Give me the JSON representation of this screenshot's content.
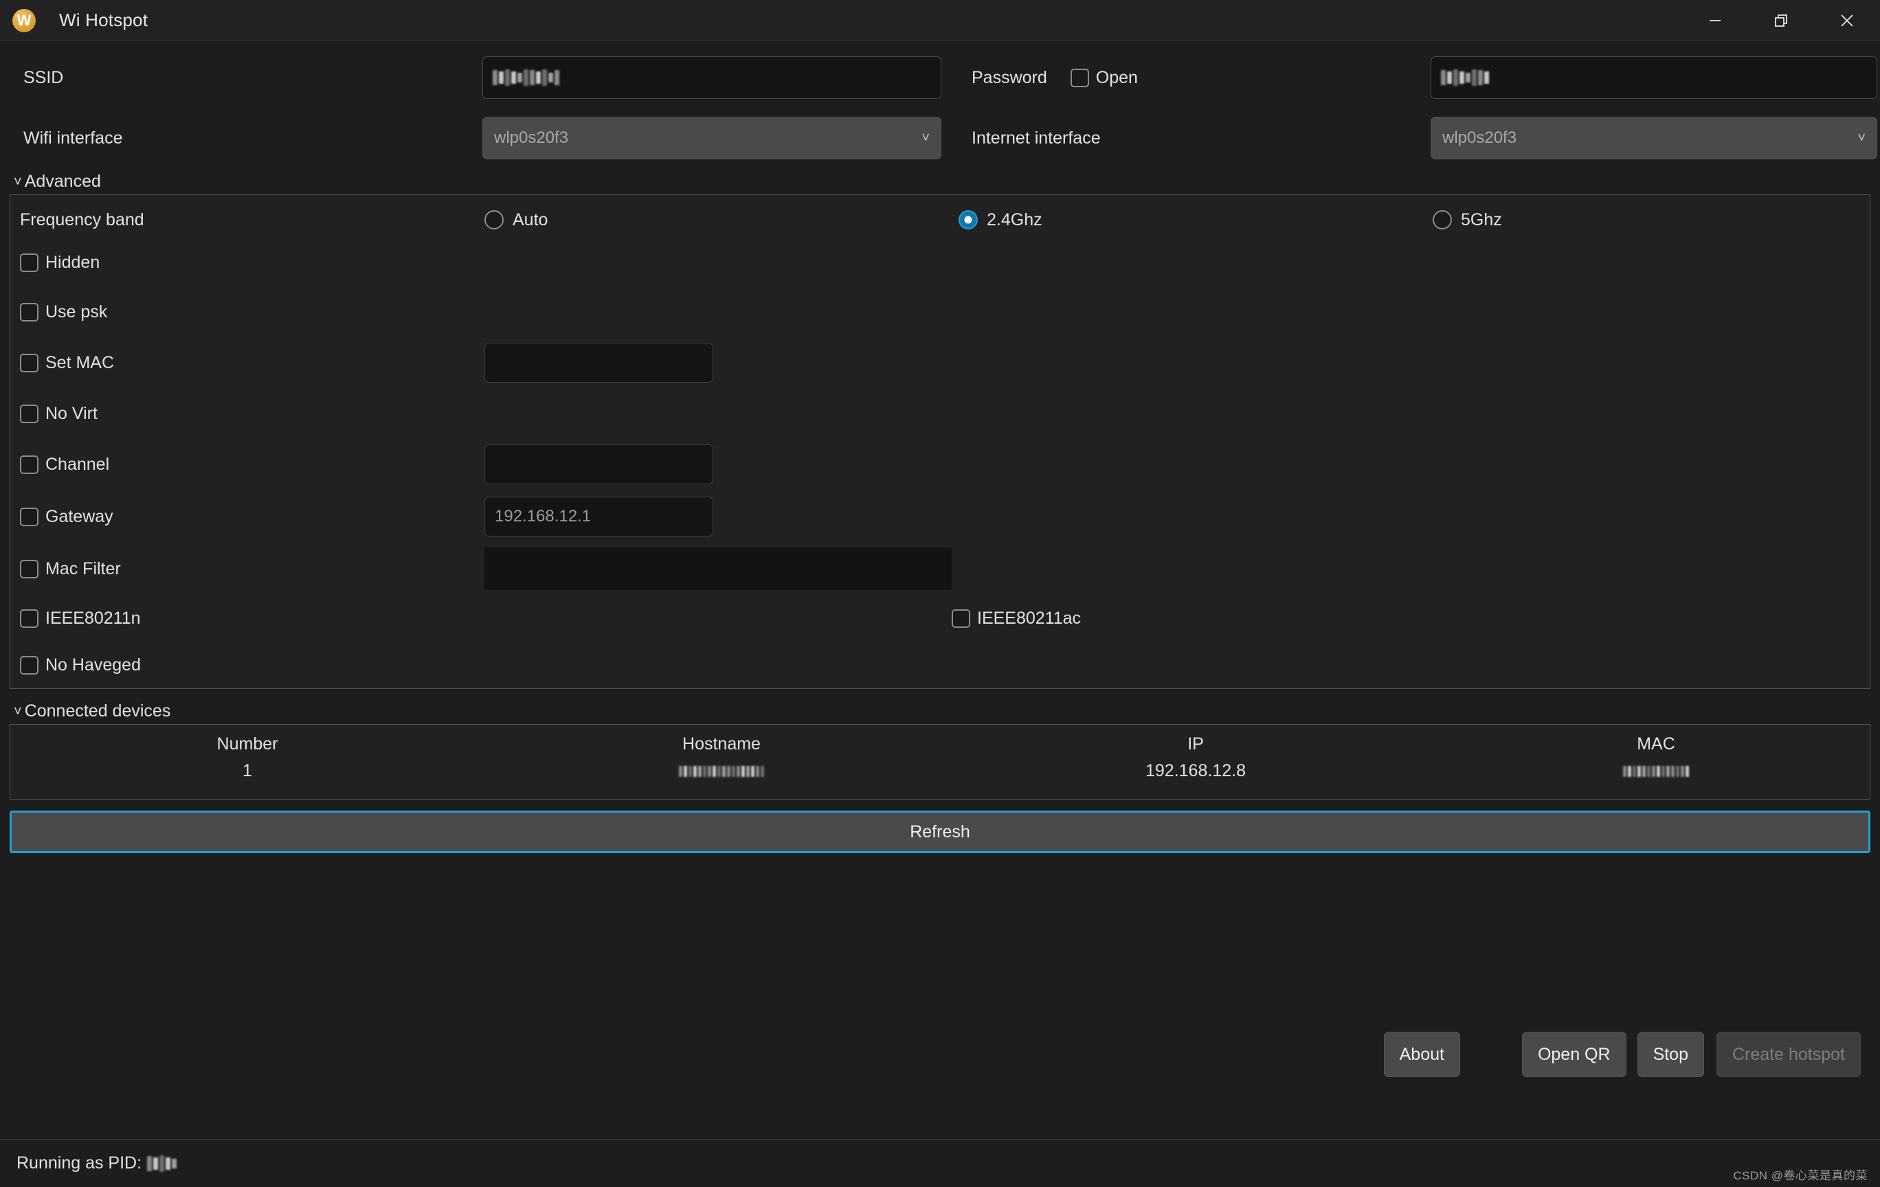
{
  "window": {
    "title": "Wi Hotspot",
    "logo_letter": "W",
    "controls": {
      "minimize": "—",
      "restore": "restore",
      "close": "✕"
    }
  },
  "form": {
    "ssid_label": "SSID",
    "ssid_value": "",
    "ssid_redacted": true,
    "password_label": "Password",
    "open_label": "Open",
    "open_checked": false,
    "password_value": "",
    "password_redacted": true,
    "wifi_interface_label": "Wifi interface",
    "wifi_interface_value": "wlp0s20f3",
    "internet_interface_label": "Internet interface",
    "internet_interface_value": "wlp0s20f3",
    "dropdown_icon": "chevron-down"
  },
  "advanced": {
    "section_label": "Advanced",
    "expanded": true,
    "frequency_band_label": "Frequency band",
    "bands": [
      {
        "label": "Auto",
        "selected": false
      },
      {
        "label": "2.4Ghz",
        "selected": true
      },
      {
        "label": "5Ghz",
        "selected": false
      }
    ],
    "options": [
      {
        "label": "Hidden",
        "checked": false,
        "input": null
      },
      {
        "label": "Use psk",
        "checked": false,
        "input": null
      },
      {
        "label": "Set MAC",
        "checked": false,
        "input": {
          "value": "",
          "placeholder": "",
          "style": "small"
        }
      },
      {
        "label": "No Virt",
        "checked": false,
        "input": null
      },
      {
        "label": "Channel",
        "checked": false,
        "input": {
          "value": "",
          "placeholder": "",
          "style": "small"
        }
      },
      {
        "label": "Gateway",
        "checked": false,
        "input": {
          "value": "",
          "placeholder": "192.168.12.1",
          "style": "small"
        }
      },
      {
        "label": "Mac Filter",
        "checked": false,
        "input": {
          "value": "",
          "placeholder": "",
          "style": "wide"
        }
      }
    ],
    "ieee_n_label": "IEEE80211n",
    "ieee_n_checked": false,
    "ieee_ac_label": "IEEE80211ac",
    "ieee_ac_checked": false,
    "no_haveged_label": "No Haveged",
    "no_haveged_checked": false
  },
  "connected_devices": {
    "section_label": "Connected devices",
    "expanded": true,
    "columns": [
      "Number",
      "Hostname",
      "IP",
      "MAC"
    ],
    "rows": [
      {
        "number": "1",
        "hostname": "",
        "hostname_redacted": true,
        "ip": "192.168.12.8",
        "mac": "",
        "mac_redacted": true
      }
    ],
    "refresh_label": "Refresh"
  },
  "actions": {
    "about": "About",
    "open_qr": "Open QR",
    "stop": "Stop",
    "create_hotspot": "Create hotspot",
    "create_hotspot_disabled": true
  },
  "statusbar": {
    "pid_label": "Running as PID:",
    "pid_value": "",
    "pid_redacted": true,
    "watermark": "CSDN @卷心菜是真的菜"
  },
  "colors": {
    "accent": "#1e9fd8",
    "window_bg": "#1d1d1d",
    "titlebar_bg": "#222222",
    "field_bg": "#141414",
    "button_bg": "#4a4a4a",
    "logo": "#d99b2e"
  }
}
